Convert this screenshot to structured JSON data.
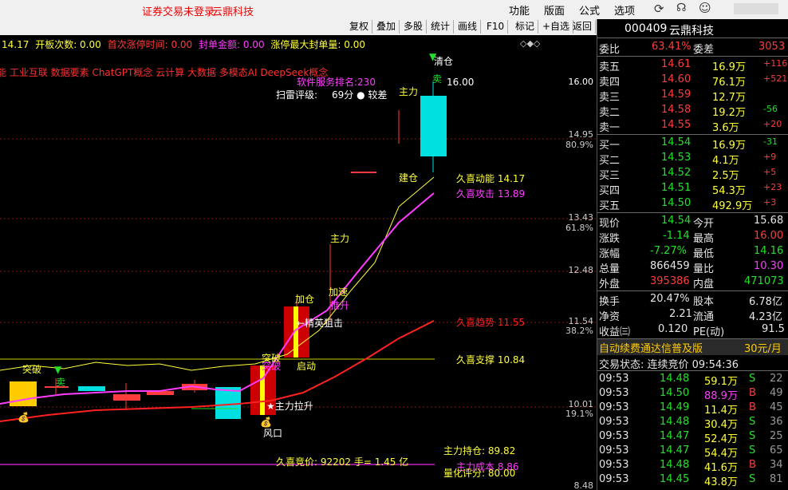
{
  "topbar": {
    "notice": "证券交易未登录",
    "stock_name": "云鼎科技",
    "menus": [
      "功能",
      "版面",
      "公式",
      "选项"
    ]
  },
  "toolbar": {
    "buttons": [
      "复权",
      "叠加",
      "多股",
      "统计",
      "画线",
      "F10",
      "标记",
      "+自选",
      "返回"
    ]
  },
  "info_line": {
    "price": "14.17",
    "items": [
      "开板次数: 0.00",
      "首次涨停时间: 0.00",
      "封单金额: 0.00",
      "涨停最大封单量: 0.00"
    ]
  },
  "concept_line": "能 工业互联 数据要素 ChatGPT概念 云计算 大数据 多模态AI DeepSeek概念",
  "chart": {
    "rank_label": "软件服务排名:230",
    "scan_label": "扫雷评级:",
    "scan_value": "69分 ● 较差",
    "y_labels": [
      "16.00",
      "14.95",
      "80.9%",
      "13.43",
      "61.8%",
      "12.48",
      "11.54",
      "38.2%",
      "10.01",
      "19.1%",
      "8.48"
    ],
    "indicators": [
      {
        "label": "久喜动能 14.17",
        "color": "#ffff3a"
      },
      {
        "label": "久喜攻击 13.89",
        "color": "#ff3cff"
      },
      {
        "label": "久喜趋势 11.55",
        "color": "#ff2020"
      },
      {
        "label": "久喜支撑 10.84",
        "color": "#ffff3a"
      }
    ],
    "annotations": {
      "qingcang": "清仓",
      "mai1": "卖",
      "zhuli1": "主力",
      "jiancang": "建仓",
      "zhuli2": "主力",
      "jiasu": "加速",
      "tuisheng": "推升",
      "jiacang": "加仓",
      "jingying": "←精英狙击",
      "tupo1": "突破",
      "tupo2": "突破",
      "qidong": "启动",
      "zhulilasheng": "★主力拉升",
      "fengkou": "风口",
      "mai2": "卖",
      "caisheng": "突破"
    },
    "bottom": {
      "zhuli_chicang": "主力持仓: 89.82",
      "zhuli_chengben": "主力成本 8.86",
      "liangneng": "量化评分: 80.00",
      "jingjia": "久喜竞价: 92202 手= 1.45 亿"
    }
  },
  "panel": {
    "code": "000409",
    "name": "云鼎科技",
    "weibi_label": "委比",
    "weibi_value": "63.41%",
    "weicha_label": "委差",
    "weicha_value": "3053",
    "asks": [
      {
        "label": "卖五",
        "price": "14.61",
        "vol": "16.9万",
        "chg": "+116"
      },
      {
        "label": "卖四",
        "price": "14.60",
        "vol": "76.1万",
        "chg": "+521"
      },
      {
        "label": "卖三",
        "price": "14.59",
        "vol": "12.7万",
        "chg": ""
      },
      {
        "label": "卖二",
        "price": "14.58",
        "vol": "19.2万",
        "chg": "-56"
      },
      {
        "label": "卖一",
        "price": "14.55",
        "vol": "3.6万",
        "chg": "+20"
      }
    ],
    "bids": [
      {
        "label": "买一",
        "price": "14.54",
        "vol": "16.9万",
        "chg": "-31"
      },
      {
        "label": "买二",
        "price": "14.53",
        "vol": "4.1万",
        "chg": "+9"
      },
      {
        "label": "买三",
        "price": "14.52",
        "vol": "2.5万",
        "chg": "+5"
      },
      {
        "label": "买四",
        "price": "14.51",
        "vol": "54.3万",
        "chg": "+23"
      },
      {
        "label": "买五",
        "price": "14.50",
        "vol": "492.9万",
        "chg": "+3"
      }
    ],
    "quote": [
      {
        "l1": "现价",
        "v1": "14.54",
        "c1": "green",
        "l2": "今开",
        "v2": "15.68",
        "c2": "white"
      },
      {
        "l1": "涨跌",
        "v1": "-1.14",
        "c1": "green",
        "l2": "最高",
        "v2": "16.00",
        "c2": "red"
      },
      {
        "l1": "涨幅",
        "v1": "-7.27%",
        "c1": "green",
        "l2": "最低",
        "v2": "14.16",
        "c2": "green"
      },
      {
        "l1": "总量",
        "v1": "866459",
        "c1": "white",
        "l2": "量比",
        "v2": "10.30",
        "c2": "mag"
      },
      {
        "l1": "外盘",
        "v1": "395386",
        "c1": "red",
        "l2": "内盘",
        "v2": "471073",
        "c2": "green"
      }
    ],
    "stats": [
      {
        "l1": "换手",
        "v1": "20.47%",
        "l2": "股本",
        "v2": "6.78亿"
      },
      {
        "l1": "净资",
        "v1": "2.21",
        "l2": "流通",
        "v2": "4.23亿"
      },
      {
        "l1": "收益㈢",
        "v1": "0.120",
        "l2": "PE(动)",
        "v2": "91.5"
      }
    ],
    "promo": "自动续费通达信普及版",
    "promo_price": "30元/月",
    "trade_status": "交易状态: 连续竞价 09:54:36",
    "ticks": [
      {
        "time": "09:53",
        "price": "14.48",
        "vol": "59.1万",
        "bs": "S",
        "n": "22"
      },
      {
        "time": "09:53",
        "price": "14.50",
        "vol": "88.9万",
        "bs": "B",
        "n": "49"
      },
      {
        "time": "09:53",
        "price": "14.49",
        "vol": "11.4万",
        "bs": "B",
        "n": "45"
      },
      {
        "time": "09:53",
        "price": "14.48",
        "vol": "30.4万",
        "bs": "S",
        "n": "36"
      },
      {
        "time": "09:53",
        "price": "14.47",
        "vol": "52.4万",
        "bs": "S",
        "n": "25"
      },
      {
        "time": "09:53",
        "price": "14.47",
        "vol": "54.4万",
        "bs": "S",
        "n": "65"
      },
      {
        "time": "09:53",
        "price": "14.48",
        "vol": "41.6万",
        "bs": "B",
        "n": "34"
      },
      {
        "time": "09:53",
        "price": "14.45",
        "vol": "43.8万",
        "bs": "S",
        "n": "81"
      }
    ]
  }
}
